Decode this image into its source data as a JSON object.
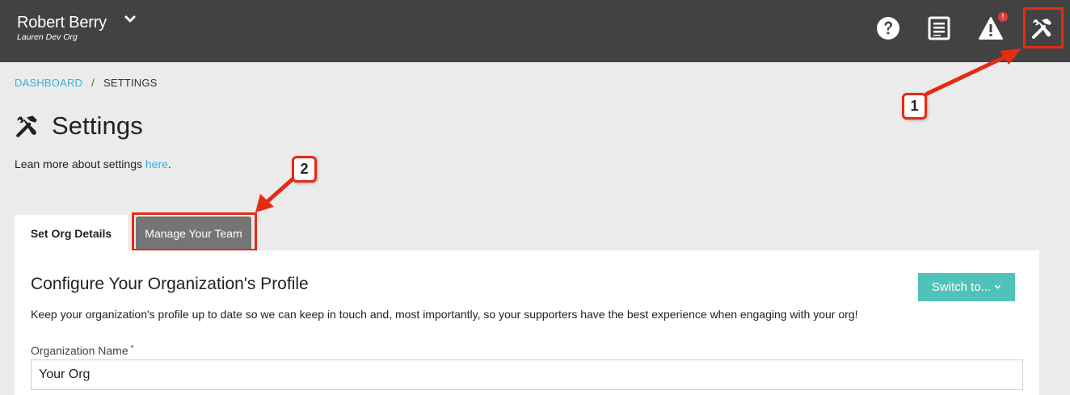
{
  "header": {
    "user_name": "Robert Berry",
    "org_name": "Lauren Dev Org",
    "alert_badge": "!"
  },
  "breadcrumb": {
    "items": [
      "DASHBOARD",
      "SETTINGS"
    ],
    "separator": "/"
  },
  "page": {
    "title": "Settings",
    "learn_more_prefix": "Lean more about settings ",
    "learn_more_link": "here",
    "learn_more_suffix": "."
  },
  "tabs": [
    {
      "label": "Set Org Details",
      "active": true
    },
    {
      "label": "Manage Your Team",
      "active": false
    }
  ],
  "profile": {
    "title": "Configure Your Organization's Profile",
    "switch_label": "Switch to...",
    "description": "Keep your organization's profile up to date so we can keep in touch and, most importantly, so your supporters have the best experience when engaging with your org!",
    "field_label": "Organization Name",
    "required_mark": "*",
    "field_value": "Your Org"
  },
  "callouts": [
    "1",
    "2"
  ],
  "colors": {
    "topbar": "#424242",
    "link": "#3aaed8",
    "accent_button": "#4fc3b9",
    "highlight": "#e52b14",
    "inactive_tab": "#757575"
  },
  "icons": [
    "chevron-down-icon",
    "help-icon",
    "notes-icon",
    "alert-icon",
    "tools-icon",
    "tools-icon"
  ]
}
